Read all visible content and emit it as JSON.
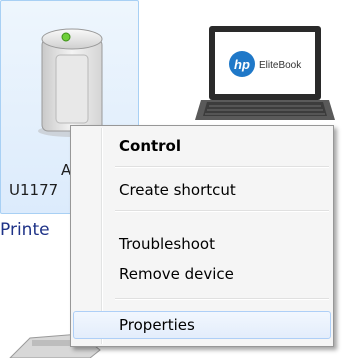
{
  "devices": {
    "printer_label_line1": "A",
    "printer_label_line2": "U1177",
    "laptop_brand": "EliteBook",
    "section_label": "Printe"
  },
  "context_menu": {
    "items": [
      {
        "label": "Control",
        "default": true
      },
      {
        "label": "Create shortcut"
      },
      {
        "label": "Troubleshoot"
      },
      {
        "label": "Remove device"
      },
      {
        "label": "Properties",
        "hovered": true
      }
    ]
  },
  "icons": {
    "printer": "printer-tower-icon",
    "laptop": "laptop-icon",
    "brand_logo": "hp-logo-icon"
  }
}
